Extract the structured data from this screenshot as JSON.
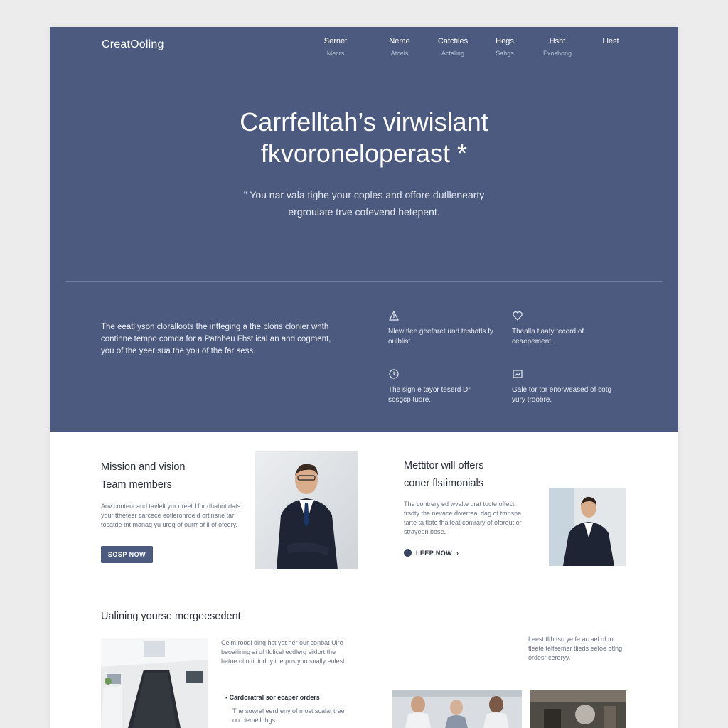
{
  "brand": {
    "logo": "CreatOoling"
  },
  "nav": [
    {
      "label": "Sernet",
      "sub": "Mecrs"
    },
    {
      "label": "Neme",
      "sub": "Atcels"
    },
    {
      "label": "Catctiles",
      "sub": "Actaling"
    },
    {
      "label": "Hegs",
      "sub": "Sahgs"
    },
    {
      "label": "Hsht",
      "sub": "Exosbong"
    },
    {
      "label": "Llest",
      "sub": ""
    }
  ],
  "hero": {
    "title_line1": "Carrfelltah’s virwislant",
    "title_line2": "fkvoroneloperast *",
    "subtitle_line1": "\" You nar vala tighe your coples and offore dutllenearty",
    "subtitle_line2": "ergrouiate trve cofevend hetepent.",
    "description": "The eeatl yson cloralloots the intfeging a the ploris clonier whth continne tempo comda for a Pathbeu Fhst ical an and cogment, you of the yeer sua the you of the far sess."
  },
  "features": [
    {
      "icon": "triangle-icon",
      "text": "Nlew tlee geefaret und tesbatls fy oulblist."
    },
    {
      "icon": "heart-icon",
      "text": "Thealla tlaaty tecerd of ceaepement."
    },
    {
      "icon": "clock-icon",
      "text": "The sign e tayor teserd Dr sosgcp tuore."
    },
    {
      "icon": "chart-icon",
      "text": "Gale tor tor enorweased of sotg yury troobre."
    }
  ],
  "mission": {
    "title": "Mission and vision",
    "subtitle": "Team members",
    "body": "Aov content and tavlelt yur dreeld for dhabot dats your ttheteer carcece eotleronroeld ortinsne tar tocatde tnt manag yu ureg of ourrr of il of ofeery.",
    "button": "SOSP NOW"
  },
  "mentor": {
    "title": "Mettitor will offers",
    "subtitle": "coner flstimonials",
    "body": "The contrery ed wvalte drat tocte offect, frsdty the nevace diverreal dag of tmnsne tarte ta tlate fhaifeat comrary of oforeut or strayepn bose.",
    "link": "LEEP NOW"
  },
  "outline": {
    "title": "Ualining yourse mergeesedent",
    "body": "Ceim roodl ding hst yat her our conbat Ulre beoailinng ai of tlolicel ecdlerg siklort the hetoe otlo tiniodhy ihe pus you soally enlest.",
    "bullet": "Cardoratral sor ecaper orders",
    "bullet_body": "The sowral eerd eny of most scalat tree oo clemelldhgs.",
    "aside": "Leest tlth tso ye fe ac ael of to fleete telfsemer tlieds eefoe otlng ordesr cereryy."
  },
  "colors": {
    "hero_bg": "#4b5a7e",
    "page_bg": "#ececec",
    "content_bg": "#ffffff",
    "accent": "#4b5a7e"
  }
}
